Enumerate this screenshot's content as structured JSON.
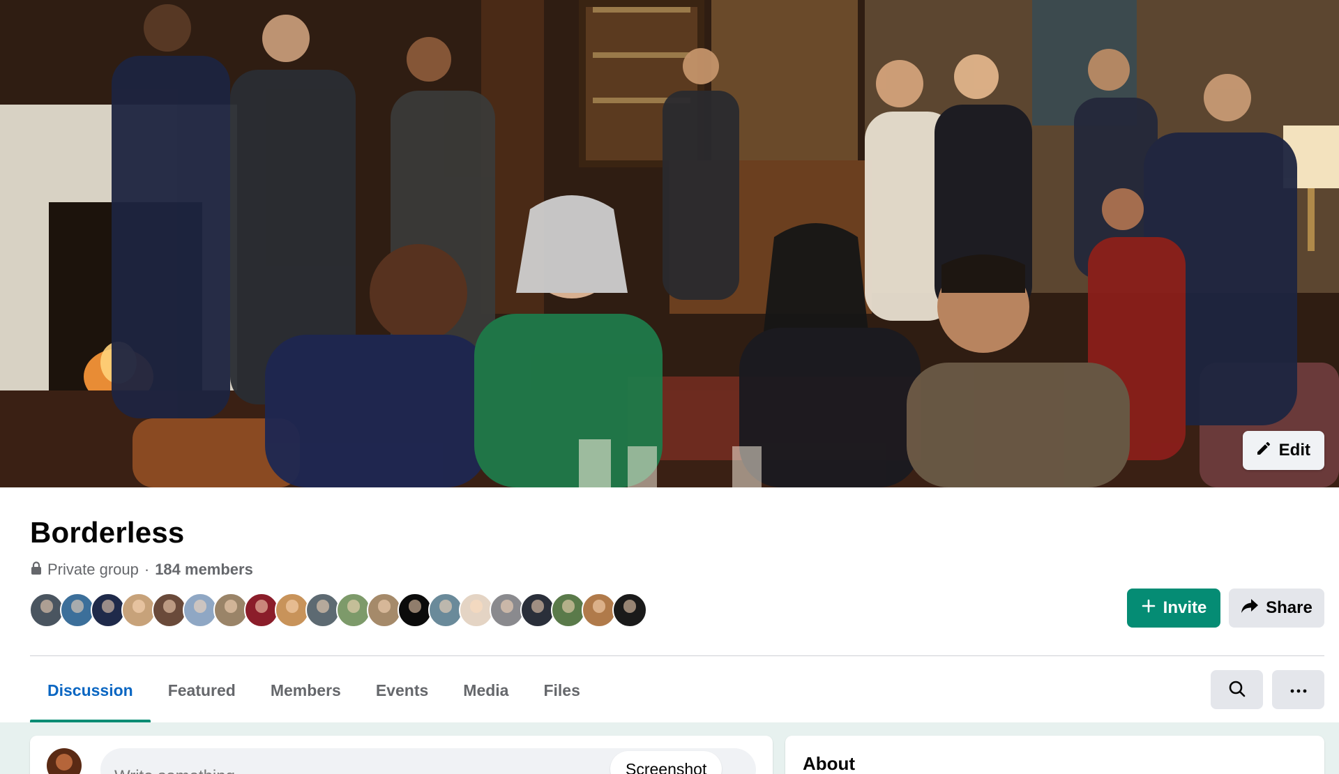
{
  "cover": {
    "edit_label": "Edit",
    "image_alt": "Group cover photo"
  },
  "group": {
    "name": "Borderless",
    "privacy": "Private group",
    "separator": "·",
    "members": "184 members"
  },
  "member_avatars": [
    {
      "color": "#4a5560"
    },
    {
      "color": "#3c6f9a"
    },
    {
      "color": "#1f2a4a"
    },
    {
      "color": "#c7a27a"
    },
    {
      "color": "#6a4a3a"
    },
    {
      "color": "#8fa7c4"
    },
    {
      "color": "#9a8468"
    },
    {
      "color": "#8b1d2a"
    },
    {
      "color": "#c8935a"
    },
    {
      "color": "#5d6a72"
    },
    {
      "color": "#7d9a6a"
    },
    {
      "color": "#a58a6a"
    },
    {
      "color": "#0b0b0b"
    },
    {
      "color": "#6a8a9a"
    },
    {
      "color": "#e4d4c4"
    },
    {
      "color": "#8a8a8e"
    },
    {
      "color": "#2a2f3a"
    },
    {
      "color": "#5a7a4a"
    },
    {
      "color": "#b07a4a"
    },
    {
      "color": "#1a1a1a"
    }
  ],
  "actions": {
    "invite_label": "Invite",
    "share_label": "Share"
  },
  "tabs": [
    {
      "label": "Discussion",
      "active": true
    },
    {
      "label": "Featured",
      "active": false
    },
    {
      "label": "Members",
      "active": false
    },
    {
      "label": "Events",
      "active": false
    },
    {
      "label": "Media",
      "active": false
    },
    {
      "label": "Files",
      "active": false
    }
  ],
  "composer": {
    "placeholder": "Write something...",
    "chip_label": "Screenshot"
  },
  "about": {
    "title": "About"
  },
  "colors": {
    "accent_green": "#058c74",
    "active_tab_text": "#0a66c2",
    "muted_text": "#65676b",
    "button_gray": "#e4e6eb"
  },
  "icons": {
    "edit": "pencil-icon",
    "lock": "lock-icon",
    "invite": "plus-icon",
    "share": "share-arrow-icon",
    "search": "search-icon",
    "more": "more-icon"
  }
}
